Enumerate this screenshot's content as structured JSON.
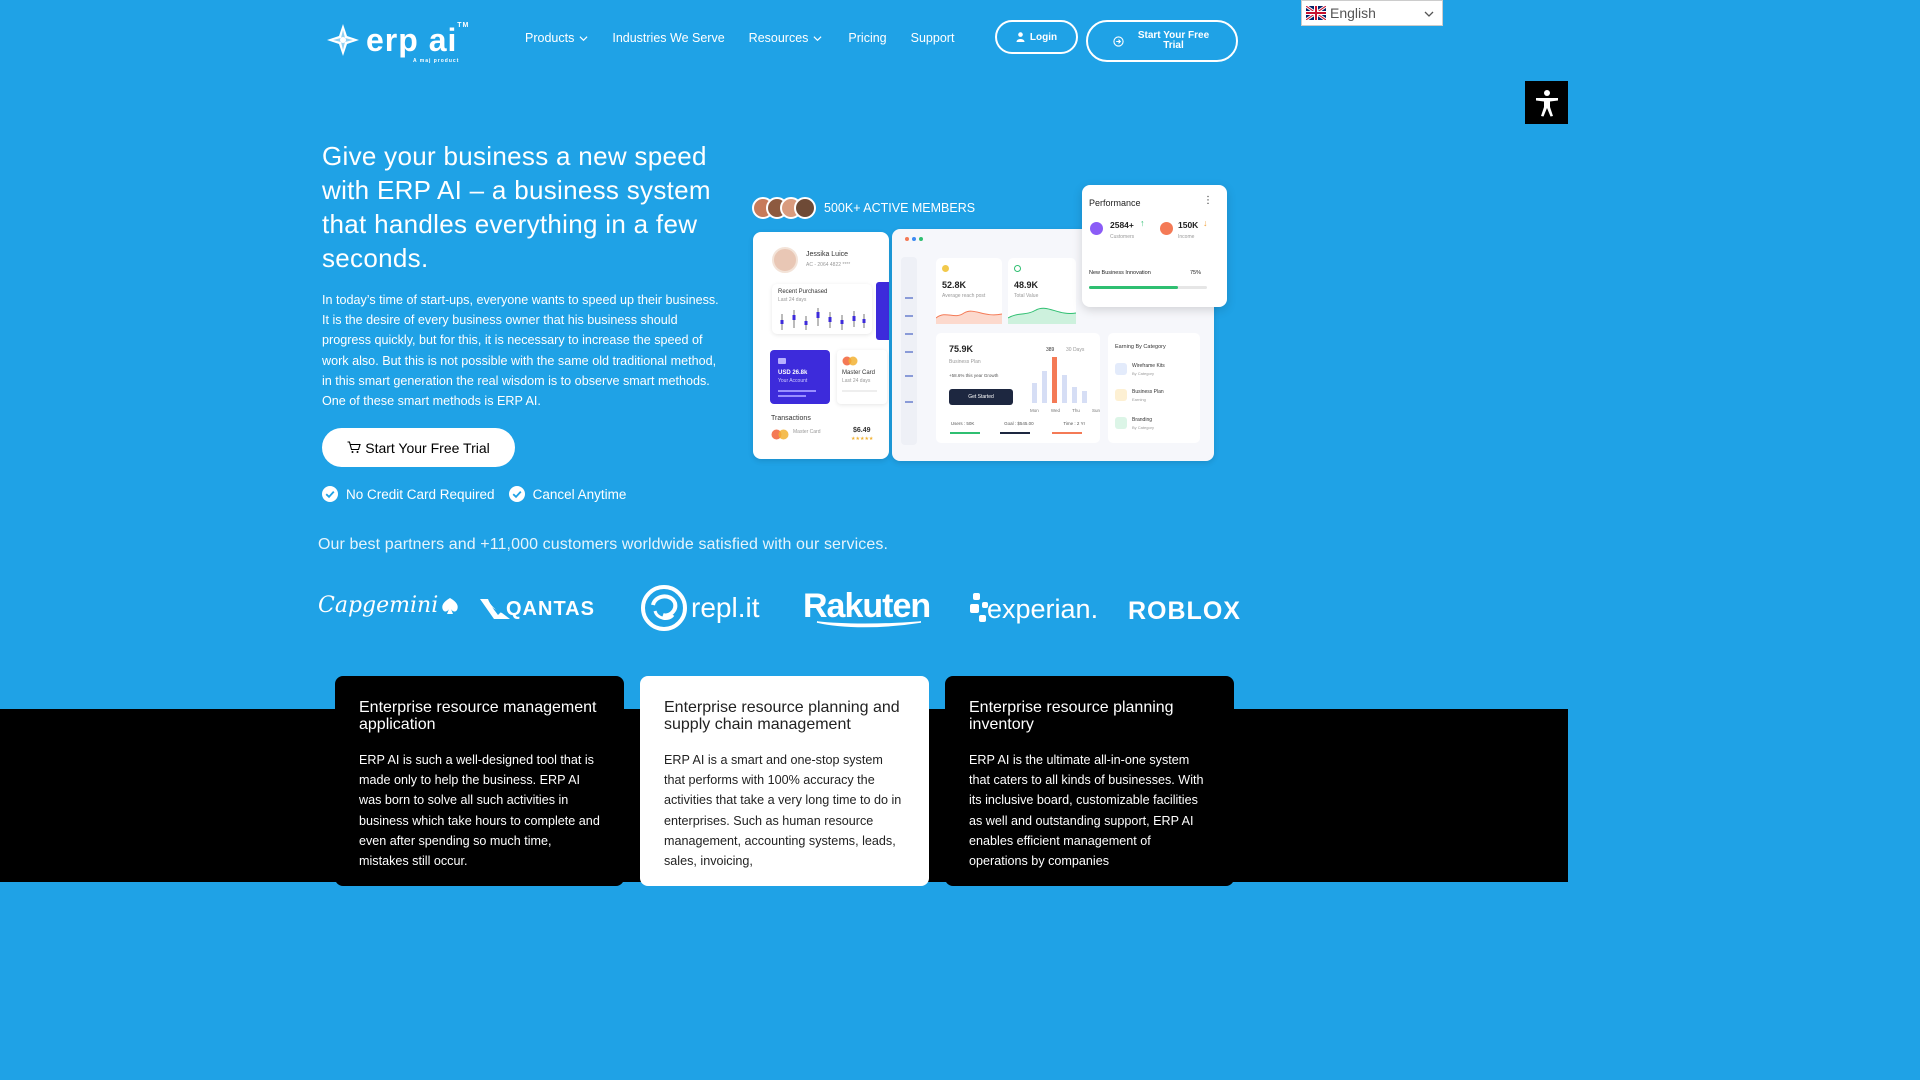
{
  "header": {
    "logo_text": "erp ai",
    "logo_tm": "TM",
    "logo_sub": "A maj product",
    "nav": [
      {
        "label": "Products",
        "dropdown": true
      },
      {
        "label": "Industries We Serve",
        "dropdown": false
      },
      {
        "label": "Resources",
        "dropdown": true
      },
      {
        "label": "Pricing",
        "dropdown": false
      },
      {
        "label": "Support",
        "dropdown": false
      }
    ],
    "login_label": "Login",
    "trial_label": "Start Your Free Trial"
  },
  "language": {
    "selected": "English"
  },
  "hero": {
    "title": "Give your business a new speed with ERP AI – a business system that handles everything in a few seconds.",
    "paragraph": "In today’s time of start-ups, everyone wants to speed up their business. It is the desire of every business owner that his business should progress quickly, but for this, it is necessary to increase the speed of work also. But this is not possible with the same old traditional method, in this smart generation the real wisdom is to observe smart methods. One of these smart methods is ERP AI.",
    "cta_label": "Start Your Free Trial",
    "checks": [
      "No Credit Card Required",
      "Cancel Anytime"
    ]
  },
  "dashboard": {
    "members_label": "500K+ ACTIVE MEMBERS",
    "profile": {
      "name": "Jessika Luice",
      "id": "AC - 2064 4822 ****"
    },
    "recent": {
      "title": "Recent Purchased",
      "sub": "Last 24 days"
    },
    "card1": {
      "amount": "USD 26.8k",
      "sub": "Your Account"
    },
    "card2": {
      "title": "Master Card",
      "sub": "Last 24 days"
    },
    "transactions": {
      "title": "Transactions",
      "name": "Master Card",
      "value": "$6.49"
    },
    "stat1": {
      "value": "52.8K",
      "label": "Average reach post"
    },
    "stat2": {
      "value": "48.9K",
      "label": "Total Value"
    },
    "plan": {
      "value": "75.9K",
      "label": "Business Plan",
      "growth": "+58.6% this year Growth",
      "button": "Get Started",
      "days_label": "30 Days"
    },
    "bar_peak": "389",
    "days": [
      "Mon",
      "Wed",
      "Thu",
      "Sun"
    ],
    "footer_stats": [
      "Users : 50K",
      "Goal : $545.00",
      "Time : 2 Yr"
    ],
    "earning": {
      "title": "Earning By Category",
      "items": [
        {
          "title": "Wireframe Kits",
          "sub": "By Category"
        },
        {
          "title": "Business Plan",
          "sub": "Earning"
        },
        {
          "title": "Branding",
          "sub": "By Category"
        }
      ]
    },
    "performance": {
      "title": "Performance",
      "customers": "2584+",
      "customers_label": "Customers",
      "income": "150K",
      "income_label": "Income",
      "innovation_label": "New Business Innovation",
      "innovation_pct": "75%",
      "innovation_value": 0.75
    }
  },
  "partners": {
    "line": "Our best partners and +11,000 customers worldwide satisfied with our services.",
    "logos": [
      "Capgemini",
      "QANTAS",
      "repl.it",
      "Rakuten",
      "experian.",
      "ROBLOX"
    ]
  },
  "features": [
    {
      "title": "Enterprise resource management application",
      "text": "ERP AI is such a well-designed tool that is made only to help the business. ERP AI was born to solve all such activities in business which take hours to complete and even after spending so much time, mistakes still occur."
    },
    {
      "title": "Enterprise resource planning and supply chain management",
      "text": "ERP AI is a smart and one-stop system that performs with 100% accuracy the activities that take a very long time to do in enterprises. Such as  human resource management, accounting systems, leads, sales, invoicing,"
    },
    {
      "title": "Enterprise resource planning inventory",
      "text": "ERP AI is the ultimate all-in-one system that caters to all kinds of businesses. With its inclusive board, customizable facilities as well and outstanding support, ERP AI enables efficient management of operations by companies"
    }
  ],
  "colors": {
    "brand": "#1fa2e6",
    "dark": "#000000",
    "accent_purple": "#3d2bdb",
    "accent_orange": "#f47a56",
    "accent_green": "#2fbf71"
  }
}
